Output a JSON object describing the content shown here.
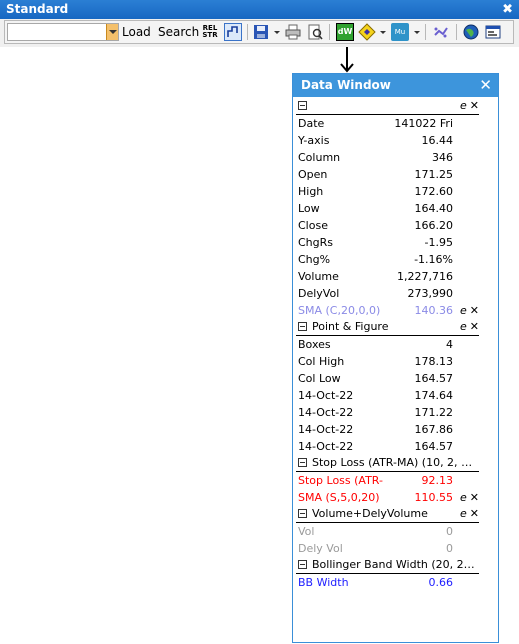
{
  "toolbar": {
    "title": "Standard",
    "close_glyph": "✖",
    "combo_value": "",
    "load_label": "Load",
    "search_label": "Search",
    "relstr_top": "REL",
    "relstr_bottom": "STR",
    "dw_button_label": "dW",
    "mu_button_label": "Mu",
    "icons": [
      "relstr-icon",
      "pf-chart-icon",
      "save-icon",
      "print-icon",
      "print-preview-icon",
      "data-window-icon",
      "diamond-tool-icon",
      "mu-tool-icon",
      "star-tool-icon",
      "globe-icon",
      "window-icon"
    ]
  },
  "data_window": {
    "title": "Data Window",
    "close_glyph": "✕",
    "main": {
      "rows": [
        {
          "label": "Date",
          "value": "141022 Fri"
        },
        {
          "label": "Y-axis",
          "value": "16.44"
        },
        {
          "label": "Column",
          "value": "346"
        },
        {
          "label": "Open",
          "value": "171.25"
        },
        {
          "label": "High",
          "value": "172.60"
        },
        {
          "label": "Low",
          "value": "164.40"
        },
        {
          "label": "Close",
          "value": "166.20"
        },
        {
          "label": "ChgRs",
          "value": "-1.95"
        },
        {
          "label": "Chg%",
          "value": "-1.16%"
        },
        {
          "label": "Volume",
          "value": "1,227,716"
        },
        {
          "label": "DelyVol",
          "value": "273,990"
        }
      ],
      "sma": {
        "label": "SMA (C,20,0,0)",
        "value": "140.36"
      }
    },
    "pf": {
      "title": "Point & Figure",
      "rows": [
        {
          "label": "Boxes",
          "value": "4"
        },
        {
          "label": "Col High",
          "value": "178.13"
        },
        {
          "label": "Col Low",
          "value": "164.57"
        },
        {
          "label": "14-Oct-22",
          "value": "174.64"
        },
        {
          "label": "14-Oct-22",
          "value": "171.22"
        },
        {
          "label": "14-Oct-22",
          "value": "167.86"
        },
        {
          "label": "14-Oct-22",
          "value": "164.57"
        }
      ]
    },
    "stoploss": {
      "title": "Stop Loss (ATR-MA) (10, 2, 20...",
      "rows": [
        {
          "label": "Stop Loss (ATR-",
          "value": "92.13"
        },
        {
          "label": "SMA (S,5,0,20)",
          "value": "110.55"
        }
      ]
    },
    "volume": {
      "title": "Volume+DelyVolume",
      "rows": [
        {
          "label": "Vol",
          "value": "0"
        },
        {
          "label": "Dely Vol",
          "value": "0"
        }
      ]
    },
    "bbw": {
      "title": "Bollinger Band Width (20, 2, C...",
      "rows": [
        {
          "label": "BB Width",
          "value": "0.66"
        }
      ]
    },
    "edit_glyph": "e",
    "remove_glyph": "✕",
    "colors": {
      "sma_main": "#8a8ae6",
      "stoploss": "#ff0000",
      "volume": "#9a9a9a",
      "bbw": "#2020ff",
      "title_bar": "#3d95dc"
    }
  }
}
